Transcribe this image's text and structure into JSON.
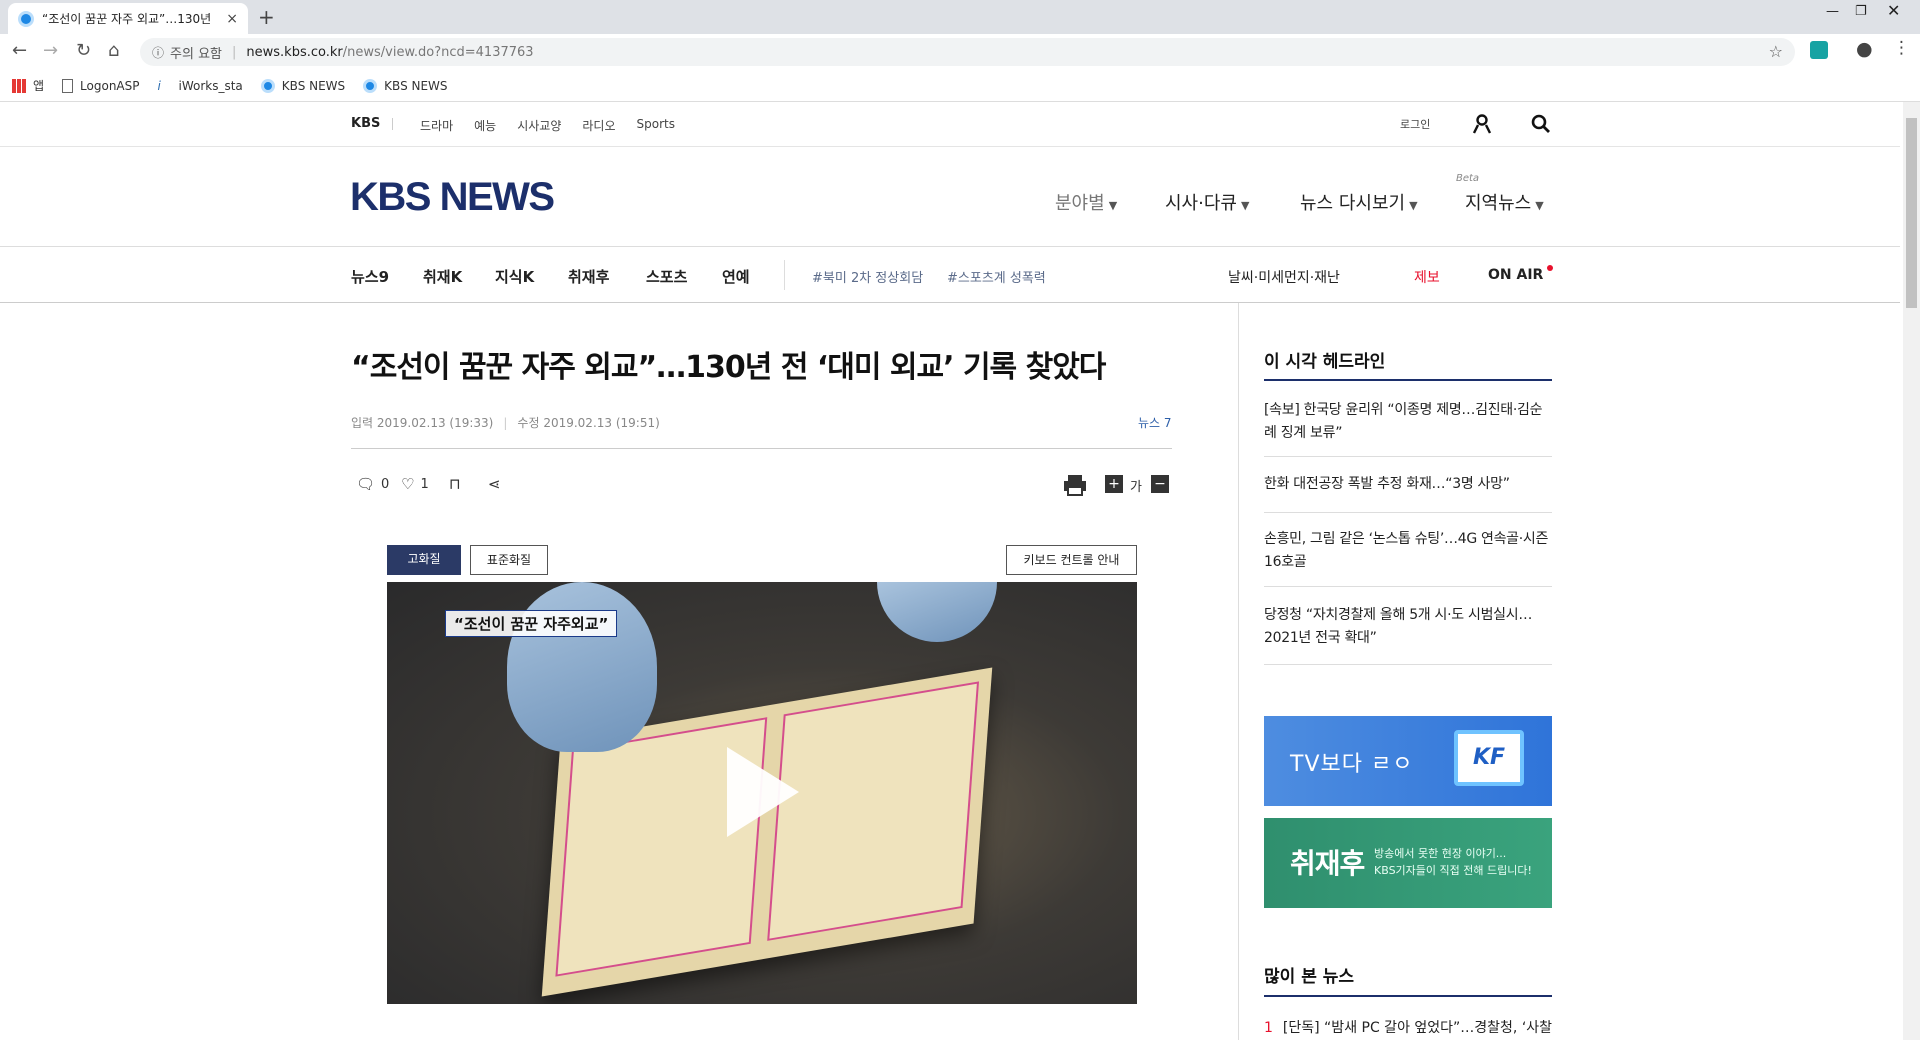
{
  "browser": {
    "tab_title": "“조선이 꿈꾼 자주 외교”…130년",
    "close_glyph": "×",
    "new_tab_glyph": "+",
    "security_label": "주의 요함",
    "url_host": "news.kbs.co.kr",
    "url_path": "/news/view.do?ncd=4137763",
    "bookmarks": [
      "앱",
      "LogonASP",
      "iWorks_sta",
      "KBS NEWS",
      "KBS NEWS"
    ]
  },
  "topbar": {
    "brand": "KBS",
    "links": [
      "드라마",
      "예능",
      "시사교양",
      "라디오",
      "Sports"
    ],
    "login": "로그인"
  },
  "header": {
    "logo": "KBS NEWS",
    "nav": [
      "분야별",
      "시사·다큐",
      "뉴스 다시보기",
      "지역뉴스"
    ],
    "beta": "Beta"
  },
  "subnav": {
    "items": [
      "뉴스9",
      "취재K",
      "지식K",
      "취재후",
      "스포츠",
      "연예"
    ],
    "tags": [
      "#북미 2차 정상회담",
      "#스포츠계 성폭력"
    ],
    "right": [
      "날씨·미세먼지·재난",
      "제보",
      "ON AIR"
    ]
  },
  "article": {
    "headline": "“조선이 꿈꾼 자주 외교”…130년 전 ‘대미 외교’ 기록 찾았다",
    "input_date": "입력 2019.02.13 (19:33)",
    "edit_date": "수정 2019.02.13 (19:51)",
    "program": "뉴스 7",
    "comment_count": "0",
    "like_count": "1",
    "font_label": "가",
    "quality_hd": "고화질",
    "quality_sd": "표준화질",
    "keyboard_guide": "키보드 컨트롤 안내",
    "video_caption": "“조선이 꿈꾼 자주외교”"
  },
  "sidebar": {
    "headline_title": "이 시각 헤드라인",
    "headlines": [
      "[속보] 한국당 윤리위 “이종명 제명…김진태·김순례 징계 보류”",
      "한화 대전공장 폭발 추정 화재…“3명 사망”",
      "손흥민, 그림 같은 ‘논스톱 슈팅’…4G 연속골·시즌 16호골",
      "당정청 “자치경찰제 올해 5개 시·도 시범실시…2021년 전국 확대”"
    ],
    "banner1_text": "TV보다 ㄹㅇ",
    "banner1_logo": "KF",
    "banner2_title": "취재후",
    "banner2_sub1": "방송에서 못한 현장 이야기...",
    "banner2_sub2": "KBS기자들이 직접 전해 드립니다!",
    "most_read_title": "많이 본 뉴스",
    "most_read_1_rank": "1",
    "most_read_1": "[단독] “밤새 PC 갈아 엎었다”…경찰청, ‘사찰"
  },
  "colors": {
    "brand_navy": "#1c2f6b",
    "accent_red": "#e8112d"
  }
}
